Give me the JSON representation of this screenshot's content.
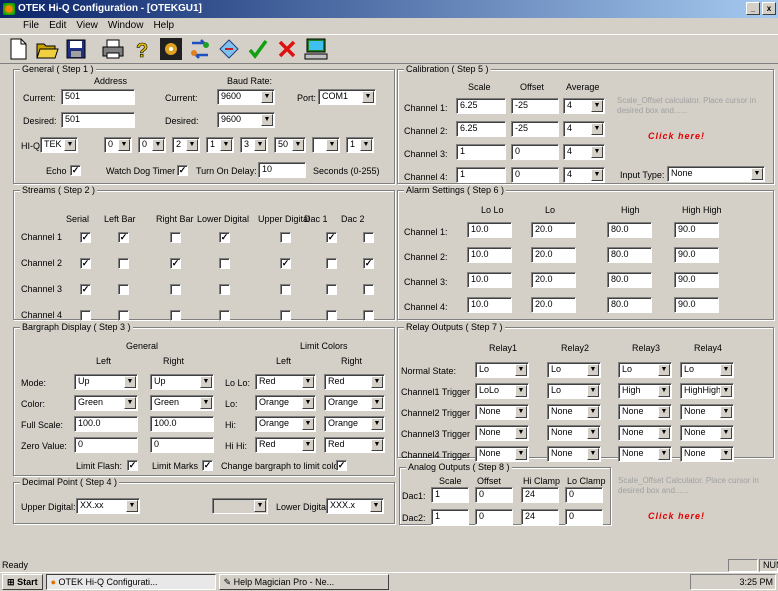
{
  "window": {
    "title": "OTEK Hi-Q Configuration - [OTEKGU1]",
    "min": "_",
    "close": "x"
  },
  "menu": [
    "File",
    "Edit",
    "View",
    "Window",
    "Help"
  ],
  "icons": [
    "new-icon",
    "open-icon",
    "save-icon",
    "print-icon",
    "help-icon",
    "settings-icon",
    "convert-icon",
    "swap-icon",
    "check-icon",
    "cancel-icon",
    "network-icon"
  ],
  "general": {
    "title": "General ( Step 1 )",
    "address_hdr": "Address",
    "baud_hdr": "Baud Rate:",
    "current_lbl": "Current:",
    "current_addr": "501",
    "current_baud_lbl": "Current:",
    "current_baud": "9600",
    "port_lbl": "Port:",
    "port": "COM1",
    "desired_lbl": "Desired:",
    "desired_addr": "501",
    "desired_baud_lbl": "Desired:",
    "desired_baud": "9600",
    "hiq_lbl": "HI-Q",
    "hiq": [
      "TEK",
      "0",
      "0",
      "2",
      "1",
      "3",
      "50",
      "",
      "1"
    ],
    "echo_lbl": "Echo",
    "watchdog_lbl": "Watch Dog Timer",
    "turn_on_lbl": "Turn On Delay:",
    "turn_on": "10",
    "seconds_lbl": "Seconds (0-255)"
  },
  "streams": {
    "title": "Streams ( Step 2 )",
    "cols": [
      "Serial",
      "Left Bar",
      "Right Bar",
      "Lower Digital",
      "Upper Digital",
      "Dac 1",
      "Dac 2"
    ],
    "rows": [
      {
        "label": "Channel 1",
        "checks": [
          true,
          true,
          false,
          true,
          false,
          true,
          false
        ]
      },
      {
        "label": "Channel 2",
        "checks": [
          true,
          false,
          true,
          false,
          true,
          false,
          true
        ]
      },
      {
        "label": "Channel 3",
        "checks": [
          true,
          false,
          false,
          false,
          false,
          false,
          false
        ]
      },
      {
        "label": "Channel 4",
        "checks": [
          false,
          false,
          false,
          false,
          false,
          false,
          false
        ]
      }
    ]
  },
  "bargraph": {
    "title": "Bargraph Display ( Step 3 )",
    "general_hdr": "General",
    "limit_hdr": "Limit Colors",
    "left_hdr": "Left",
    "right_hdr": "Right",
    "limit_left_hdr": "Left",
    "limit_right_hdr": "Right",
    "mode_lbl": "Mode:",
    "mode_l": "Up",
    "mode_r": "Up",
    "lolo_lbl": "Lo Lo:",
    "lolo_l": "Red",
    "lolo_r": "Red",
    "color_lbl": "Color:",
    "color_l": "Green",
    "color_r": "Green",
    "lo_lbl": "Lo:",
    "lo_l": "Orange",
    "lo_r": "Orange",
    "fullscale_lbl": "Full Scale:",
    "fullscale_l": "100.0",
    "fullscale_r": "100.0",
    "hi_lbl": "Hi:",
    "hi_l": "Orange",
    "hi_r": "Orange",
    "zero_lbl": "Zero Value:",
    "zero_l": "0",
    "zero_r": "0",
    "hihi_lbl": "Hi Hi:",
    "hihi_l": "Red",
    "hihi_r": "Red",
    "limit_flash_lbl": "Limit Flash:",
    "limit_marks_lbl": "Limit Marks",
    "change_lbl": "Change bargraph to limit color"
  },
  "decimal": {
    "title": "Decimal Point ( Step 4 )",
    "upper_lbl": "Upper Digital:",
    "upper": "XX.xx",
    "middle": "",
    "lower_lbl": "Lower Digital:",
    "lower": "XXX.x"
  },
  "calibration": {
    "title": "Calibration ( Step 5 )",
    "scale_hdr": "Scale",
    "offset_hdr": "Offset",
    "avg_hdr": "Average",
    "rows": [
      {
        "label": "Channel 1:",
        "scale": "6.25",
        "offset": "-25",
        "avg": "4"
      },
      {
        "label": "Channel 2:",
        "scale": "6.25",
        "offset": "-25",
        "avg": "4"
      },
      {
        "label": "Channel 3:",
        "scale": "1",
        "offset": "0",
        "avg": "4"
      },
      {
        "label": "Channel 4:",
        "scale": "1",
        "offset": "0",
        "avg": "4"
      }
    ],
    "hint": "Scale_Offset calculator. Place cursor in desired box and......",
    "click": "Click here!",
    "input_type_lbl": "Input Type:",
    "input_type": "None"
  },
  "alarm": {
    "title": "Alarm Settings ( Step 6 )",
    "cols": [
      "Lo Lo",
      "Lo",
      "High",
      "High High"
    ],
    "rows": [
      {
        "label": "Channel 1:",
        "vals": [
          "10.0",
          "20.0",
          "80.0",
          "90.0"
        ]
      },
      {
        "label": "Channel 2:",
        "vals": [
          "10.0",
          "20.0",
          "80.0",
          "90.0"
        ]
      },
      {
        "label": "Channel 3:",
        "vals": [
          "10.0",
          "20.0",
          "80.0",
          "90.0"
        ]
      },
      {
        "label": "Channel 4:",
        "vals": [
          "10.0",
          "20.0",
          "80.0",
          "90.0"
        ]
      }
    ]
  },
  "relay": {
    "title": "Relay Outputs ( Step 7 )",
    "cols": [
      "Relay1",
      "Relay2",
      "Relay3",
      "Relay4"
    ],
    "rows": [
      {
        "label": "Normal State:",
        "vals": [
          "Lo",
          "Lo",
          "Lo",
          "Lo"
        ]
      },
      {
        "label": "Channel1 Trigger",
        "vals": [
          "LoLo",
          "Lo",
          "High",
          "HighHigh"
        ]
      },
      {
        "label": "Channel2 Trigger",
        "vals": [
          "None",
          "None",
          "None",
          "None"
        ]
      },
      {
        "label": "Channel3 Trigger",
        "vals": [
          "None",
          "None",
          "None",
          "None"
        ]
      },
      {
        "label": "Channel4 Trigger",
        "vals": [
          "None",
          "None",
          "None",
          "None"
        ]
      }
    ]
  },
  "analog": {
    "title": "Analog Outputs ( Step 8 )",
    "cols": [
      "Scale",
      "Offset",
      "Hi Clamp",
      "Lo Clamp"
    ],
    "rows": [
      {
        "label": "Dac1:",
        "vals": [
          "1",
          "0",
          "24",
          "0"
        ]
      },
      {
        "label": "Dac2:",
        "vals": [
          "1",
          "0",
          "24",
          "0"
        ]
      }
    ],
    "hint": "Scale_Offset Calculator. Place cursor in desired box and......",
    "click": "Click here!"
  },
  "status": {
    "ready": "Ready",
    "num": "NUM"
  },
  "taskbar": {
    "start": "Start",
    "tasks": [
      "OTEK Hi-Q Configurati...",
      "Help Magician Pro - Ne..."
    ],
    "clock": "3:25 PM"
  }
}
